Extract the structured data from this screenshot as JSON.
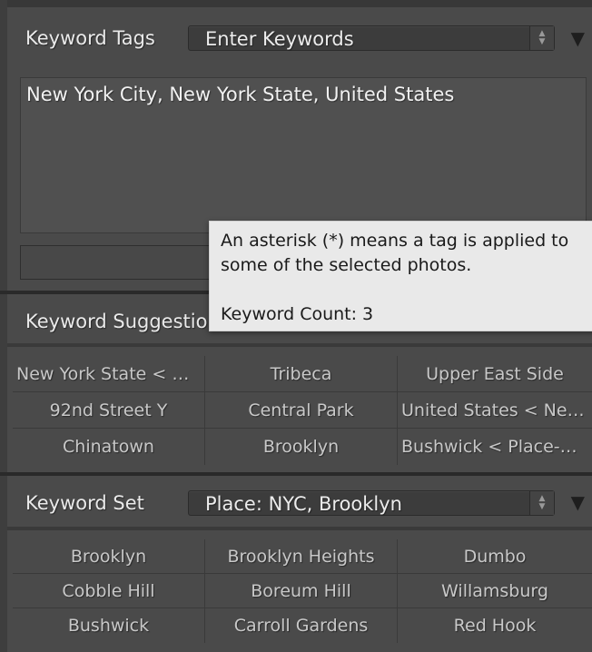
{
  "keyword_tags": {
    "title": "Keyword Tags",
    "mode": "Enter Keywords",
    "keywords_text": "New York City, New York State, United States"
  },
  "tooltip": {
    "line1": "An asterisk (*) means a tag is applied to",
    "line2": "some of the selected photos.",
    "count": "Keyword Count: 3"
  },
  "keyword_suggestions": {
    "title": "Keyword Suggestions",
    "items": [
      "New York State < New York State",
      "Tribeca",
      "Upper East Side",
      "92nd Street Y",
      "Central Park",
      "United States < New York State",
      "Chinatown",
      "Brooklyn",
      "Bushwick < Place-NYC"
    ]
  },
  "keyword_set": {
    "title": "Keyword Set",
    "selected": "Place: NYC, Brooklyn",
    "items": [
      "Brooklyn",
      "Brooklyn Heights",
      "Dumbo",
      "Cobble Hill",
      "Boreum Hill",
      "Willamsburg",
      "Bushwick",
      "Carroll Gardens",
      "Red Hook"
    ]
  }
}
